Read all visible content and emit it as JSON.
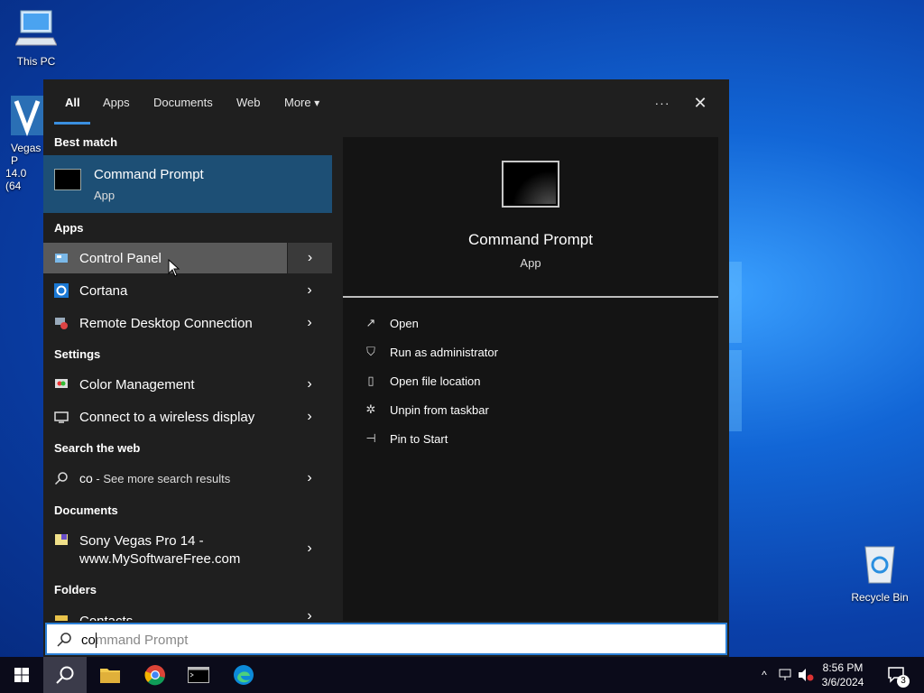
{
  "desktop": {
    "icons": [
      {
        "label": "This PC"
      },
      {
        "label": "Vegas P"
      },
      {
        "label": "14.0 (64"
      },
      {
        "label": "Recycle Bin"
      }
    ]
  },
  "search_panel": {
    "tabs": [
      {
        "label": "All",
        "active": true
      },
      {
        "label": "Apps"
      },
      {
        "label": "Documents"
      },
      {
        "label": "Web"
      },
      {
        "label": "More"
      }
    ],
    "more_caret": "▾",
    "options_label": "···",
    "close_label": "✕",
    "best_match": {
      "section_label": "Best match",
      "title": "Command Prompt",
      "subtitle": "App"
    },
    "apps": {
      "section_label": "Apps",
      "items": [
        {
          "label": "Control Panel",
          "icon": "control-panel-icon"
        },
        {
          "label": "Cortana",
          "icon": "cortana-icon"
        },
        {
          "label": "Remote Desktop Connection",
          "icon": "remote-desktop-icon"
        }
      ]
    },
    "settings": {
      "section_label": "Settings",
      "items": [
        {
          "label": "Color Management",
          "icon": "color-management-icon"
        },
        {
          "label": "Connect to a wireless display",
          "icon": "display-icon"
        }
      ]
    },
    "web": {
      "section_label": "Search the web",
      "query": "co",
      "suffix": " - See more search results"
    },
    "documents": {
      "section_label": "Documents",
      "item_line1": "Sony Vegas Pro 14 -",
      "item_line2": "www.MySoftwareFree.com"
    },
    "folders": {
      "section_label": "Folders",
      "item": "Contacts"
    },
    "arrow": "›",
    "preview": {
      "title": "Command Prompt",
      "subtitle": "App",
      "actions": [
        {
          "label": "Open",
          "icon": "open-icon"
        },
        {
          "label": "Run as administrator",
          "icon": "shield-icon"
        },
        {
          "label": "Open file location",
          "icon": "file-location-icon"
        },
        {
          "label": "Unpin from taskbar",
          "icon": "unpin-icon"
        },
        {
          "label": "Pin to Start",
          "icon": "pin-icon"
        }
      ]
    },
    "searchbox": {
      "typed": "co",
      "completion": "mmand Prompt"
    }
  },
  "taskbar": {
    "clock_time": "8:56 PM",
    "clock_date": "3/6/2024",
    "notification_count": "3",
    "accent": "#2b7fd6"
  }
}
